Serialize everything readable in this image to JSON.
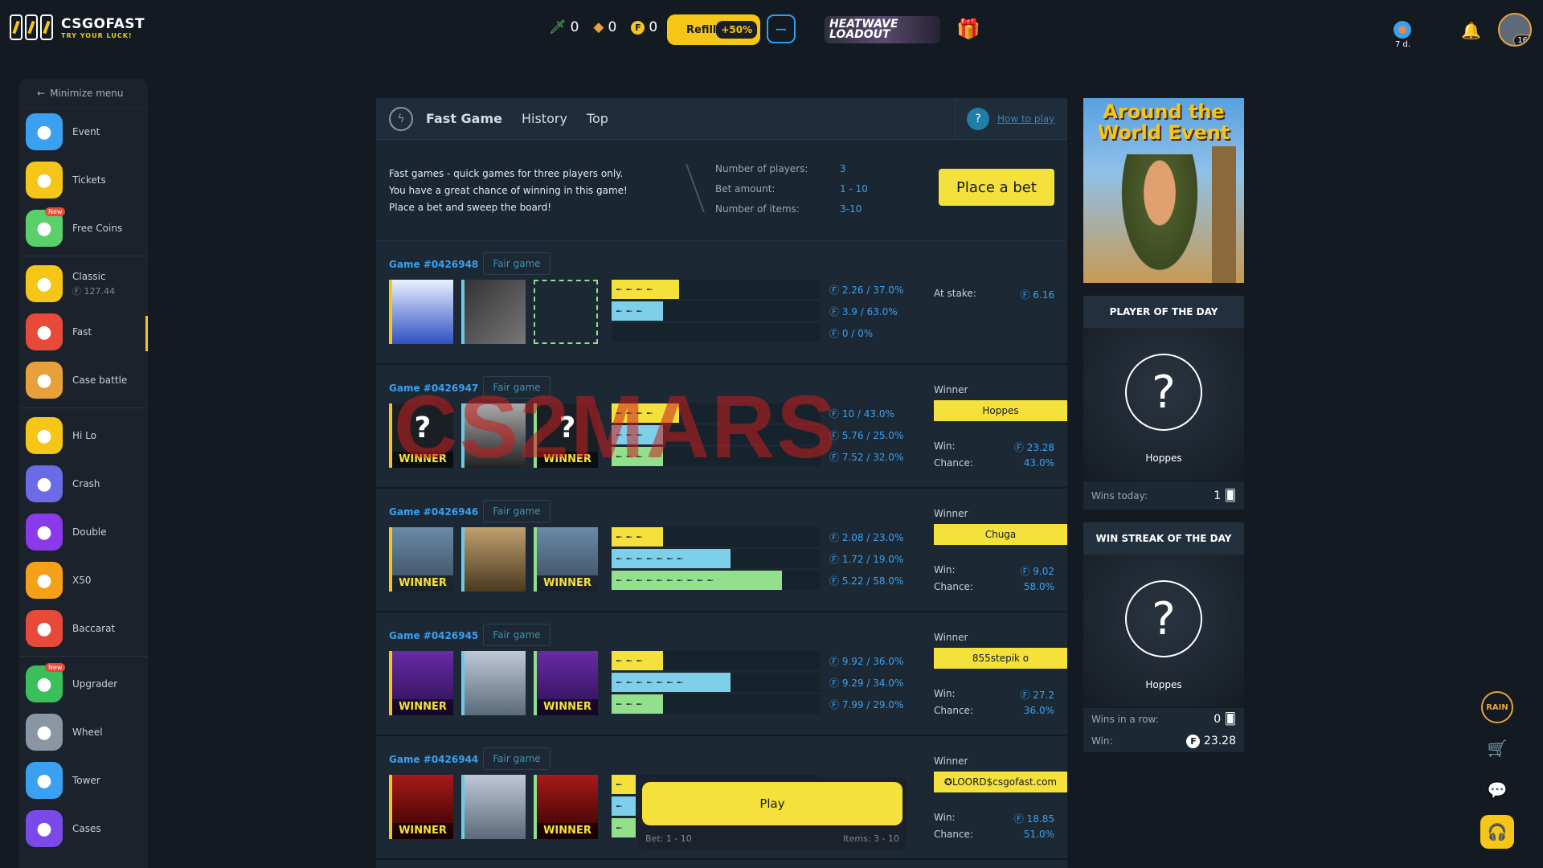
{
  "header": {
    "logo_title": "CSGOFAST",
    "logo_tagline": "TRY YOUR LUCK!",
    "balances": [
      {
        "icon": "knife-icon",
        "value": "0"
      },
      {
        "icon": "gem-icon",
        "value": "0"
      },
      {
        "icon": "coin-icon",
        "value": "0"
      }
    ],
    "refill_label": "Refill",
    "refill_bonus": "+50%",
    "promo_text": "HEATWAVE LOADOUT",
    "rain_label": "7 d.",
    "avatar_level": "16"
  },
  "sidebar": {
    "minimize_label": "Minimize menu",
    "items": [
      {
        "label": "Event",
        "icon": "event-icon",
        "color": "#3aa0f0"
      },
      {
        "label": "Tickets",
        "icon": "ticket-icon",
        "color": "#f5c518"
      },
      {
        "label": "Free Coins",
        "icon": "free-game-icon",
        "color": "#5ad06a",
        "badge": "New"
      },
      {
        "label": "Classic",
        "sub": "127.44",
        "icon": "crown-icon",
        "color": "#f5c518"
      },
      {
        "label": "Fast",
        "icon": "lightning-icon",
        "color": "#e84a3a"
      },
      {
        "label": "Case battle",
        "icon": "swords-icon",
        "color": "#e8a03a"
      },
      {
        "label": "Hi Lo",
        "icon": "hilo-icon",
        "color": "#f5c518"
      },
      {
        "label": "Crash",
        "icon": "rocket-icon",
        "color": "#6b6be8"
      },
      {
        "label": "Double",
        "icon": "double-icon",
        "color": "#8a3ae8"
      },
      {
        "label": "X50",
        "icon": "x50-icon",
        "color": "#f5a018"
      },
      {
        "label": "Baccarat",
        "icon": "baccarat-icon",
        "color": "#e84a3a"
      },
      {
        "label": "Upgrader",
        "icon": "upgrader-icon",
        "color": "#3ac05a",
        "badge": "New"
      },
      {
        "label": "Wheel",
        "icon": "wheel-icon",
        "color": "#8a96a3"
      },
      {
        "label": "Tower",
        "icon": "tower-icon",
        "color": "#3aa0f0"
      },
      {
        "label": "Cases",
        "icon": "cases-icon",
        "color": "#7a4ae8"
      }
    ]
  },
  "tabs": {
    "fast_game": "Fast Game",
    "history": "History",
    "top": "Top",
    "how_to_play": "How to play"
  },
  "info": {
    "line1": "Fast games - quick games for three players only.",
    "line2": "You have a great chance of winning in this game!",
    "line3": "Place a bet and sweep the board!",
    "players_key": "Number of players:",
    "players_val": "3",
    "bet_key": "Bet amount:",
    "bet_val": "1 -  10",
    "items_key": "Number of items:",
    "items_val": "3-10",
    "place_bet": "Place a bet"
  },
  "games": [
    {
      "id": "Game #0426948",
      "fair": "Fair game",
      "stats": [
        "2.26 / 37.0%",
        "3.9 / 63.0%",
        "0 / 0%"
      ],
      "stake_label": "At stake:",
      "stake": "6.16"
    },
    {
      "id": "Game #0426947",
      "fair": "Fair game",
      "stats": [
        "10 / 43.0%",
        "5.76 / 25.0%",
        "7.52 / 32.0%"
      ],
      "winner_label": "Winner",
      "winner": "Hoppes",
      "win_label": "Win:",
      "win": "23.28",
      "chance_label": "Chance:",
      "chance": "43.0%",
      "winner_tag": "WINNER"
    },
    {
      "id": "Game #0426946",
      "fair": "Fair game",
      "stats": [
        "2.08 / 23.0%",
        "1.72 / 19.0%",
        "5.22 / 58.0%"
      ],
      "winner_label": "Winner",
      "winner": "Chuga",
      "win_label": "Win:",
      "win": "9.02",
      "chance_label": "Chance:",
      "chance": "58.0%",
      "winner_tag": "WINNER"
    },
    {
      "id": "Game #0426945",
      "fair": "Fair game",
      "stats": [
        "9.92 / 36.0%",
        "9.29 / 34.0%",
        "7.99 / 29.0%"
      ],
      "winner_label": "Winner",
      "winner": "855stepik o",
      "win_label": "Win:",
      "win": "27.2",
      "chance_label": "Chance:",
      "chance": "36.0%",
      "winner_tag": "WINNER"
    },
    {
      "id": "Game #0426944",
      "fair": "Fair game",
      "stats": [
        "",
        "",
        ""
      ],
      "winner_label": "Winner",
      "winner": "✪LOORD$csgofast.com",
      "win_label": "Win:",
      "win": "18.85",
      "chance_label": "Chance:",
      "chance": "51.0%",
      "winner_tag": "WINNER"
    }
  ],
  "playbar": {
    "play": "Play",
    "bet": "Bet:  1 -  10",
    "items": "Items: 3 - 10"
  },
  "right": {
    "event_title": "Around the World Event",
    "potd_title": "PLAYER OF THE DAY",
    "potd_name": "Hoppes",
    "wins_today_label": "Wins today:",
    "wins_today": "1",
    "streak_title": "WIN STREAK OF THE DAY",
    "streak_name": "Hoppes",
    "wins_row_label": "Wins in a row:",
    "wins_row": "0",
    "win_label": "Win:",
    "win_val": "23.28"
  },
  "float": {
    "rain": "RAIN"
  },
  "watermark": "CS2MARS"
}
